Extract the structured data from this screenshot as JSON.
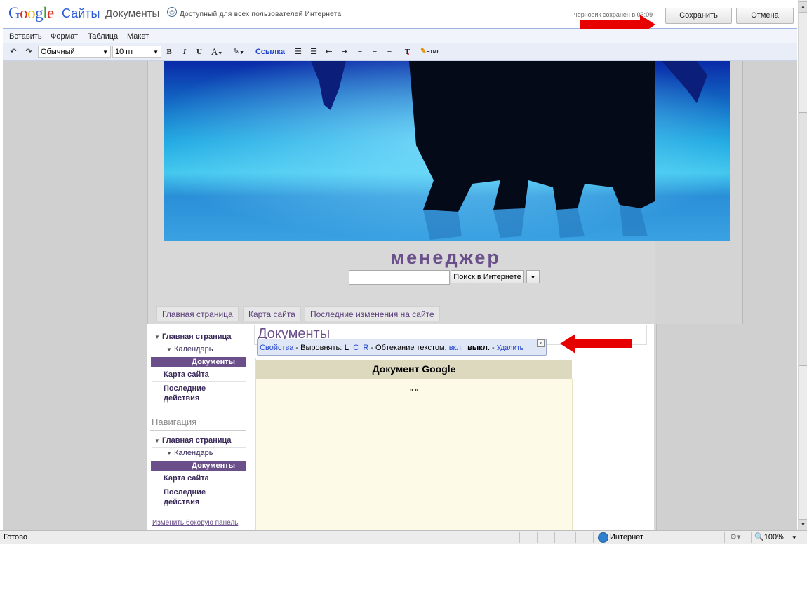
{
  "header": {
    "logo": "Google",
    "product": "Сайты",
    "page_name": "Документы",
    "access_text": "Доступный для всех пользователей Интернета",
    "draft_status": "черновик сохранен в 03:09",
    "save_label": "Сохранить",
    "cancel_label": "Отмена"
  },
  "menu": [
    "Вставить",
    "Формат",
    "Таблица",
    "Макет"
  ],
  "toolbar": {
    "style_select": "Обычный",
    "size_select": "10 пт",
    "bold": "B",
    "italic": "I",
    "underline": "U",
    "font_color": "A",
    "link_label": "Ссылка",
    "html_label": "HTML"
  },
  "site": {
    "title": "менеджер",
    "search_placeholder": "",
    "search_button": "Поиск в Интернете",
    "tabs": [
      "Главная страница",
      "Карта сайта",
      "Последние изменения на сайте"
    ]
  },
  "sidebar": {
    "items": [
      "Главная страница",
      "Календарь",
      "Документы",
      "Карта сайта",
      "Последние действия"
    ],
    "nav_heading": "Навигация",
    "nav_items": [
      "Главная страница",
      "Календарь",
      "Документы",
      "Карта сайта",
      "Последние действия"
    ],
    "edit_link": "Изменить боковую панель"
  },
  "main": {
    "title": "Документы",
    "props_bar": {
      "properties": "Свойства",
      "align_label": " - Выровнять: ",
      "align_l": "L",
      "align_c": "C",
      "align_r": "R",
      "wrap_label": " - Обтекание текстом: ",
      "wrap_on": "вкл.",
      "wrap_off": "выкл.",
      "delete": "Удалить"
    },
    "doc_title": "Документ Google",
    "doc_content": "\" \""
  },
  "statusbar": {
    "status": "Готово",
    "zone": "Интернет",
    "zoom": "100%"
  },
  "colors": {
    "accent": "#6a4f8a",
    "link": "#2244cc",
    "arrow": "#e60000"
  }
}
